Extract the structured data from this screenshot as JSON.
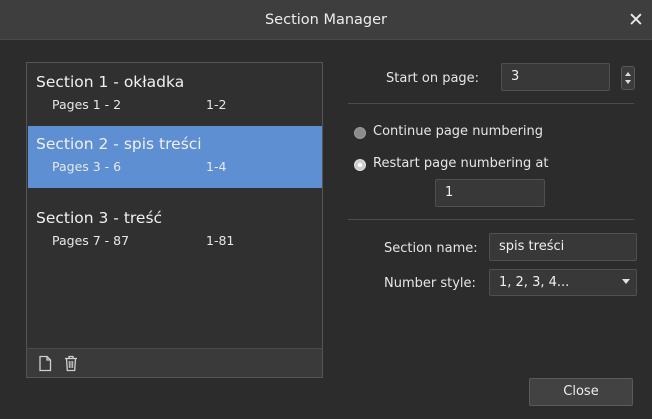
{
  "window": {
    "title": "Section Manager",
    "close_glyph": "✕"
  },
  "sections": [
    {
      "title": "Section 1 - okładka",
      "pages": "Pages 1 - 2",
      "range": "1-2",
      "selected": false
    },
    {
      "title": "Section 2 - spis treści",
      "pages": "Pages 3 - 6",
      "range": "1-4",
      "selected": true
    },
    {
      "title": "Section 3 - treść",
      "pages": "Pages 7 - 87",
      "range": "1-81",
      "selected": false
    }
  ],
  "list_footer": {
    "icons": [
      "new-page-icon",
      "trash-icon"
    ]
  },
  "start_on_page": {
    "label": "Start on page:",
    "value": "3"
  },
  "numbering": {
    "continue_label": "Continue page numbering",
    "restart_label": "Restart page numbering at",
    "selected": "restart",
    "restart_value": "1"
  },
  "section_name": {
    "label": "Section name:",
    "value": "spis treści"
  },
  "number_style": {
    "label": "Number style:",
    "value": "1, 2, 3, 4..."
  },
  "buttons": {
    "close_label": "Close"
  },
  "colors": {
    "selection": "#5d8fd2",
    "background": "#2c2c2c"
  }
}
